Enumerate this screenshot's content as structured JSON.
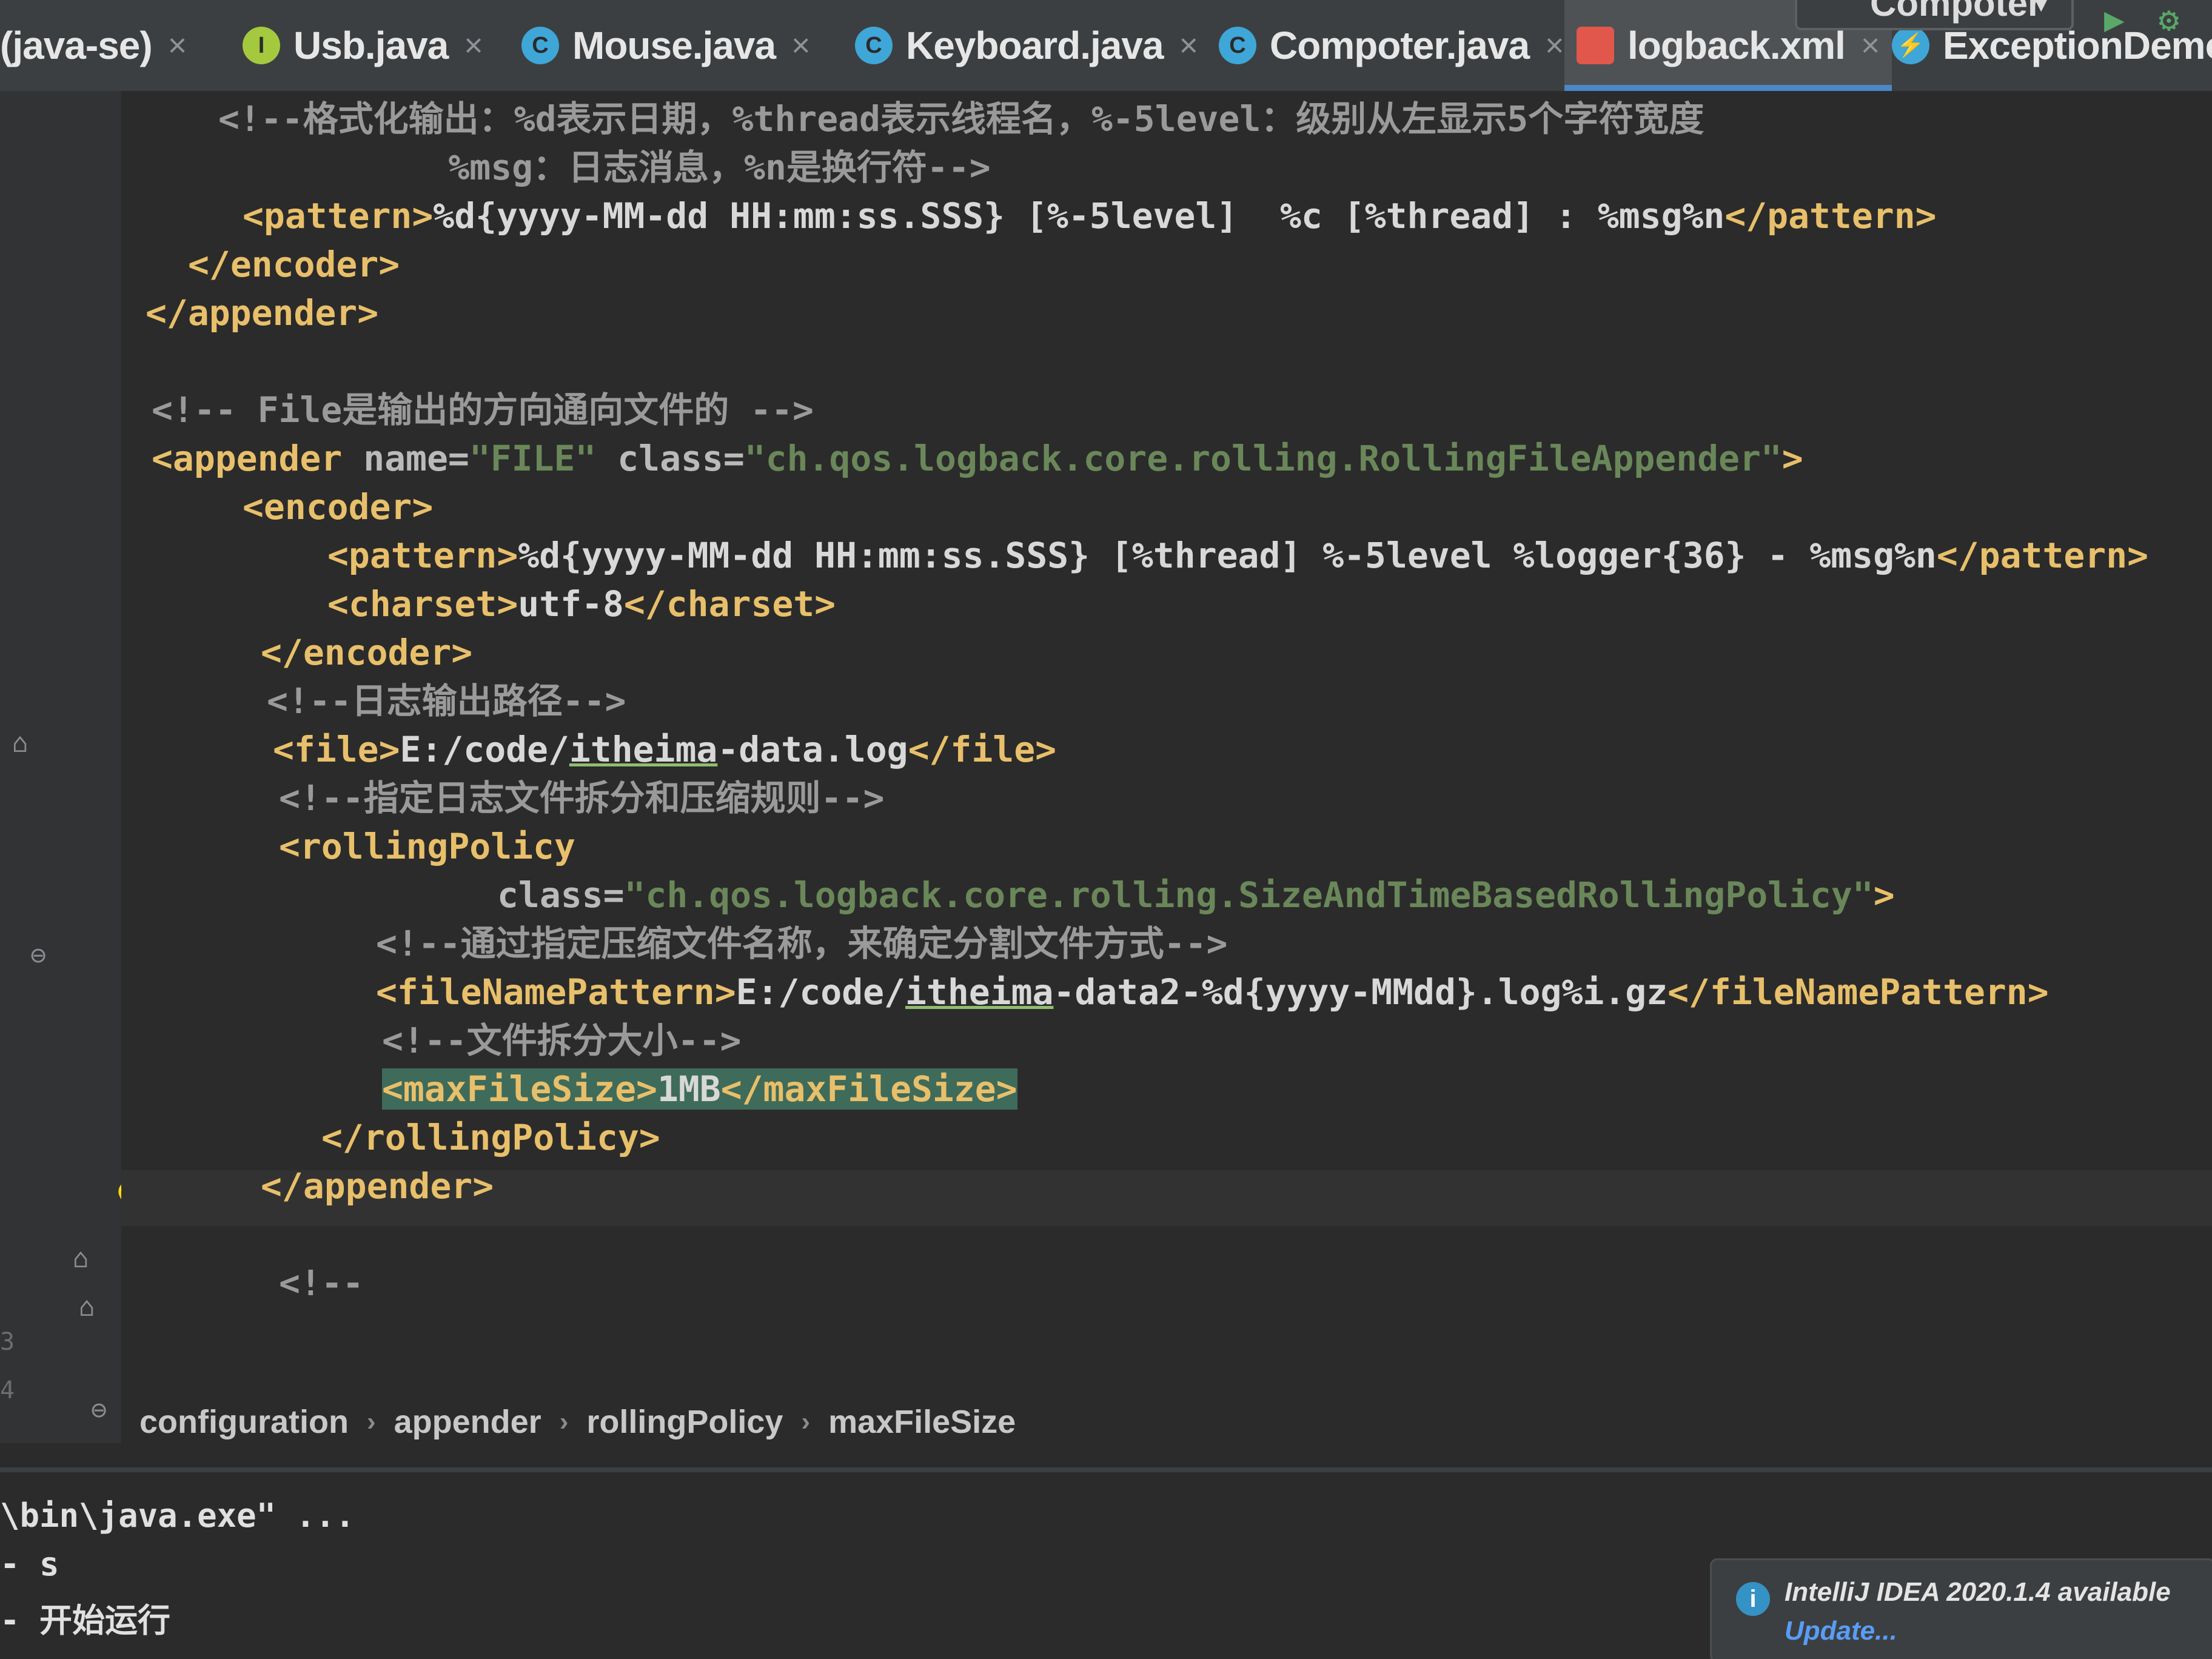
{
  "tabs": [
    {
      "label": "(java-se)",
      "icon": "none"
    },
    {
      "label": "Usb.java",
      "icon": "interface-icon",
      "icon_color": "#a4c93f",
      "icon_glyph": "I"
    },
    {
      "label": "Mouse.java",
      "icon": "class-icon",
      "icon_color": "#3fa6d8",
      "icon_glyph": "C"
    },
    {
      "label": "Keyboard.java",
      "icon": "class-icon",
      "icon_color": "#3fa6d8",
      "icon_glyph": "C"
    },
    {
      "label": "Compoter.java",
      "icon": "class-icon",
      "icon_color": "#3fa6d8",
      "icon_glyph": "C"
    },
    {
      "label": "logback.xml",
      "icon": "xml-file-icon",
      "icon_color": "#e2574c",
      "icon_glyph": "",
      "active": true
    },
    {
      "label": "ExceptionDemo.java",
      "icon": "exception-class-icon",
      "icon_color": "#3fa6d8",
      "icon_glyph": "⚡"
    }
  ],
  "toolbar": {
    "run_config": "Compoter",
    "close_glyph": "×"
  },
  "editor": {
    "lines": [
      {
        "segments": [
          [
            "cmt",
            "<!--格式化输出：%d表示日期，%thread表示线程名，%-5level：级别从左显示5个字符宽度"
          ]
        ]
      },
      {
        "segments": [
          [
            "cmt",
            "        %msg：日志消息，%n是换行符-->"
          ]
        ]
      },
      {
        "segments": [
          [
            "tag",
            "<pattern>"
          ],
          [
            "txt",
            "%d{yyyy-MM-dd HH:mm:ss.SSS} [%-5level]  %c [%thread] : %msg%n"
          ],
          [
            "tag",
            "</pattern>"
          ]
        ]
      },
      {
        "segments": [
          [
            "tag",
            "</encoder>"
          ]
        ]
      },
      {
        "segments": [
          [
            "tag",
            "</appender>"
          ]
        ]
      },
      {
        "segments": []
      },
      {
        "segments": [
          [
            "cmt",
            "<!-- File是输出的方向通向文件的 -->"
          ]
        ]
      },
      {
        "segments": [
          [
            "tag",
            "<appender "
          ],
          [
            "attr",
            "name="
          ],
          [
            "val",
            "\"FILE\" "
          ],
          [
            "attr",
            "class="
          ],
          [
            "val",
            "\"ch.qos.logback.core.rolling.RollingFileAppender\""
          ],
          [
            "tag",
            ">"
          ]
        ]
      },
      {
        "segments": [
          [
            "tag",
            "<encoder>"
          ]
        ]
      },
      {
        "segments": [
          [
            "tag",
            "<pattern>"
          ],
          [
            "txt",
            "%d{yyyy-MM-dd HH:mm:ss.SSS} [%thread] %-5level %logger{36} - %msg%n"
          ],
          [
            "tag",
            "</pattern>"
          ]
        ]
      },
      {
        "segments": [
          [
            "tag",
            "<charset>"
          ],
          [
            "txt",
            "utf-8"
          ],
          [
            "tag",
            "</charset>"
          ]
        ]
      },
      {
        "segments": [
          [
            "tag",
            "</encoder>"
          ]
        ]
      },
      {
        "segments": [
          [
            "cmt",
            "<!--日志输出路径-->"
          ]
        ]
      },
      {
        "segments": [
          [
            "tag",
            "<file>"
          ],
          [
            "txt",
            "E:/code/"
          ],
          [
            "under",
            "itheima"
          ],
          [
            "txt",
            "-data.log"
          ],
          [
            "tag",
            "</file>"
          ]
        ]
      },
      {
        "segments": [
          [
            "cmt",
            "<!--指定日志文件拆分和压缩规则-->"
          ]
        ]
      },
      {
        "segments": [
          [
            "tag",
            "<rollingPolicy"
          ]
        ]
      },
      {
        "segments": [
          [
            "attr",
            "class="
          ],
          [
            "val",
            "\"ch.qos.logback.core.rolling.SizeAndTimeBasedRollingPolicy\""
          ],
          [
            "tag",
            ">"
          ]
        ]
      },
      {
        "segments": [
          [
            "cmt",
            "<!--通过指定压缩文件名称，来确定分割文件方式-->"
          ]
        ]
      },
      {
        "segments": [
          [
            "tag",
            "<fileNamePattern>"
          ],
          [
            "txt",
            "E:/code/"
          ],
          [
            "under",
            "itheima"
          ],
          [
            "txt",
            "-data2-%d{yyyy-MMdd}.log%i.gz"
          ],
          [
            "tag",
            "</fileNamePattern>"
          ]
        ]
      },
      {
        "segments": [
          [
            "cmt",
            "<!--文件拆分大小-->"
          ]
        ]
      },
      {
        "segments": [
          [
            "hltag",
            "<maxFileSize>"
          ],
          [
            "hltxt",
            "1MB"
          ],
          [
            "hltag",
            "</maxFileSize>"
          ]
        ]
      },
      {
        "segments": [
          [
            "tag",
            "</rollingPolicy>"
          ]
        ]
      },
      {
        "segments": [
          [
            "tag",
            "</appender>"
          ]
        ]
      },
      {
        "segments": []
      },
      {
        "segments": [
          [
            "cmt",
            "<!--"
          ]
        ]
      }
    ]
  },
  "gutter": {
    "line_numbers": [
      "3",
      "4"
    ],
    "bulb": "💡"
  },
  "breadcrumbs": {
    "items": [
      "configuration",
      "appender",
      "rollingPolicy",
      "maxFileSize"
    ],
    "separator": "›"
  },
  "console": {
    "lines": [
      "\\bin\\java.exe\" ...",
      "- s",
      "- 开始运行"
    ]
  },
  "notification": {
    "icon": "i",
    "message": "IntelliJ IDEA 2020.1.4 available",
    "link": "Update..."
  }
}
